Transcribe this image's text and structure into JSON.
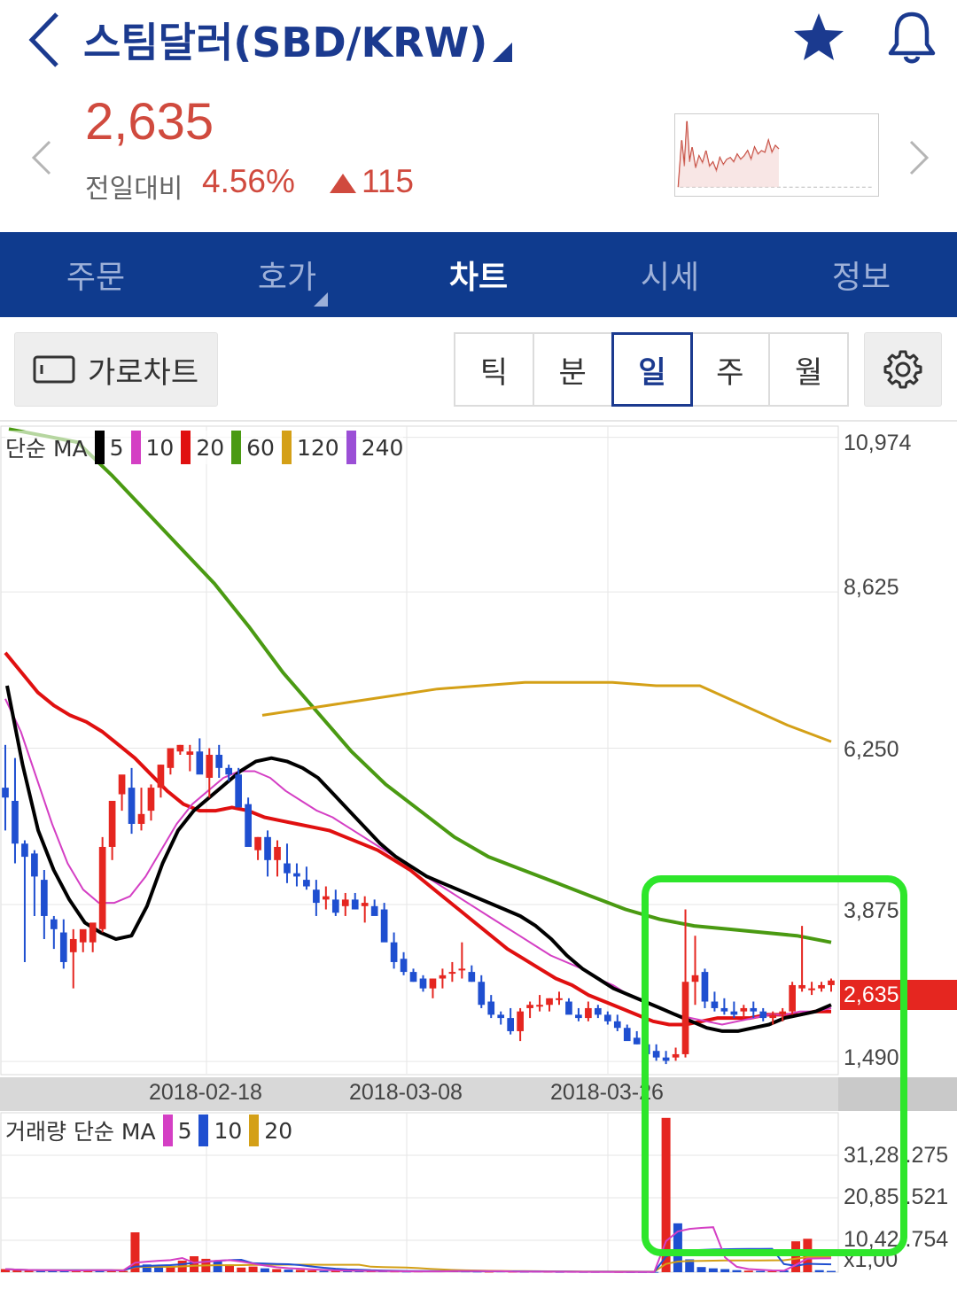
{
  "header": {
    "title": "스팀달러(SBD/KRW)",
    "icons": {
      "back": "chevron-left-icon",
      "dropdown": "caret-down-icon",
      "favorite": "star-icon",
      "alert": "bell-icon"
    },
    "colors": {
      "title": "#1b3a8f"
    }
  },
  "price": {
    "current": "2,635",
    "change_label": "전일대비",
    "change_pct": "4.56%",
    "change_abs": "115",
    "direction": "up",
    "color": "#d04a3e"
  },
  "nav": {
    "tabs": [
      {
        "label": "주문",
        "active": false
      },
      {
        "label": "호가",
        "active": false
      },
      {
        "label": "차트",
        "active": true
      },
      {
        "label": "시세",
        "active": false
      },
      {
        "label": "정보",
        "active": false
      }
    ],
    "color": "#0f3b8e"
  },
  "toolbar": {
    "landscape_label": "가로차트",
    "periods": [
      {
        "label": "틱",
        "active": false
      },
      {
        "label": "분",
        "active": false
      },
      {
        "label": "일",
        "active": true
      },
      {
        "label": "주",
        "active": false
      },
      {
        "label": "월",
        "active": false
      }
    ],
    "settings_icon": "gear-icon"
  },
  "chart_data": [
    {
      "type": "candlestick",
      "legend": {
        "label": "단순 MA",
        "periods": [
          {
            "label": "5",
            "color": "#000000"
          },
          {
            "label": "10",
            "color": "#d43fc4"
          },
          {
            "label": "20",
            "color": "#e01010"
          },
          {
            "label": "60",
            "color": "#4a9a12"
          },
          {
            "label": "120",
            "color": "#d4a017"
          },
          {
            "label": "240",
            "color": "#9b4fd6"
          }
        ]
      },
      "y_ticks": [
        "10,974",
        "8,625",
        "6,250",
        "3,875",
        "1,490"
      ],
      "y_tick_values": [
        10974,
        8625,
        6250,
        3875,
        1490
      ],
      "x_ticks": [
        "2018-02-18",
        "2018-03-08",
        "2018-03-26"
      ],
      "last_price": "2,635",
      "last_price_value": 2635,
      "up_color": "#e52620",
      "down_color": "#1f4fd0",
      "candles": [
        [
          5650,
          6300,
          5000,
          5500
        ],
        [
          5450,
          6100,
          4500,
          4800
        ],
        [
          4800,
          4850,
          3000,
          4600
        ],
        [
          4650,
          4700,
          3700,
          4300
        ],
        [
          4250,
          4400,
          3350,
          3700
        ],
        [
          3650,
          3700,
          3200,
          3500
        ],
        [
          3450,
          3650,
          2900,
          3000
        ],
        [
          3150,
          3500,
          2600,
          3350
        ],
        [
          3300,
          3400,
          3150,
          3500
        ],
        [
          3300,
          3400,
          3150,
          3600
        ],
        [
          3500,
          4900,
          3450,
          4750
        ],
        [
          4750,
          5300,
          4550,
          5450
        ],
        [
          5550,
          5700,
          5300,
          5850
        ],
        [
          5650,
          5950,
          4950,
          5100
        ],
        [
          5100,
          5650,
          5000,
          5250
        ],
        [
          5300,
          5700,
          5150,
          5650
        ],
        [
          5650,
          6000,
          5500,
          6000
        ],
        [
          5950,
          6200,
          5850,
          6250
        ],
        [
          6200,
          6300,
          6150,
          6300
        ],
        [
          6150,
          6300,
          5900,
          6200
        ],
        [
          6200,
          6400,
          5900,
          5850
        ],
        [
          5800,
          6250,
          5500,
          6150
        ],
        [
          6150,
          6300,
          5800,
          5950
        ],
        [
          5950,
          6000,
          5750,
          5850
        ],
        [
          5850,
          5950,
          5500,
          5350
        ],
        [
          5400,
          5500,
          4900,
          4750
        ],
        [
          4700,
          4900,
          4550,
          4900
        ],
        [
          4900,
          5000,
          4300,
          4550
        ],
        [
          4550,
          4850,
          4300,
          4750
        ],
        [
          4500,
          4800,
          4200,
          4350
        ],
        [
          4350,
          4500,
          4150,
          4300
        ],
        [
          4250,
          4450,
          4100,
          4150
        ],
        [
          4100,
          4250,
          3700,
          3900
        ],
        [
          3950,
          4150,
          3800,
          4000
        ],
        [
          3950,
          4100,
          3700,
          3750
        ],
        [
          3850,
          4050,
          3700,
          3950
        ],
        [
          3950,
          4050,
          3800,
          3800
        ],
        [
          3850,
          4000,
          3600,
          3900
        ],
        [
          3850,
          3950,
          3750,
          3700
        ],
        [
          3800,
          3900,
          3350,
          3300
        ],
        [
          3300,
          3450,
          2900,
          3000
        ],
        [
          3050,
          3150,
          2800,
          2850
        ],
        [
          2850,
          2900,
          2700,
          2700
        ],
        [
          2750,
          2800,
          2550,
          2600
        ],
        [
          2600,
          2750,
          2450,
          2750
        ],
        [
          2750,
          2900,
          2600,
          2800
        ],
        [
          2850,
          3000,
          2700,
          2850
        ],
        [
          2900,
          3300,
          2750,
          2900
        ],
        [
          2850,
          2950,
          2700,
          2700
        ],
        [
          2700,
          2800,
          2300,
          2350
        ],
        [
          2400,
          2500,
          2150,
          2200
        ],
        [
          2200,
          2250,
          2050,
          2150
        ],
        [
          2150,
          2300,
          1900,
          1950
        ],
        [
          1950,
          2300,
          1800,
          2250
        ],
        [
          2300,
          2400,
          2150,
          2350
        ],
        [
          2350,
          2500,
          2250,
          2350
        ],
        [
          2350,
          2450,
          2250,
          2450
        ],
        [
          2450,
          2550,
          2350,
          2450
        ],
        [
          2400,
          2450,
          2250,
          2200
        ],
        [
          2200,
          2300,
          2100,
          2150
        ],
        [
          2150,
          2400,
          2100,
          2300
        ],
        [
          2300,
          2350,
          2150,
          2200
        ],
        [
          2200,
          2250,
          2050,
          2100
        ],
        [
          2100,
          2200,
          1950,
          2000
        ],
        [
          2000,
          2050,
          1850,
          1800
        ],
        [
          1850,
          1950,
          1750,
          1750
        ],
        [
          1750,
          1850,
          1650,
          1600
        ],
        [
          1650,
          1750,
          1500,
          1550
        ],
        [
          1550,
          1650,
          1450,
          1500
        ],
        [
          1550,
          1700,
          1500,
          1600
        ],
        [
          1600,
          3800,
          1550,
          2700
        ],
        [
          2700,
          3400,
          2350,
          2800
        ],
        [
          2850,
          2900,
          2300,
          2400
        ],
        [
          2400,
          2550,
          2250,
          2300
        ],
        [
          2300,
          2450,
          2200,
          2250
        ],
        [
          2250,
          2400,
          2150,
          2200
        ],
        [
          2250,
          2350,
          2150,
          2300
        ],
        [
          2300,
          2400,
          2150,
          2250
        ],
        [
          2250,
          2300,
          2100,
          2150
        ],
        [
          2150,
          2250,
          2050,
          2200
        ],
        [
          2200,
          2300,
          2100,
          2250
        ],
        [
          2250,
          2700,
          2200,
          2650
        ],
        [
          2600,
          3550,
          2550,
          2650
        ],
        [
          2600,
          2700,
          2500,
          2600
        ],
        [
          2600,
          2700,
          2550,
          2650
        ],
        [
          2650,
          2750,
          2550,
          2720
        ]
      ],
      "ma": {
        "ma5": [
          7200,
          6000,
          5000,
          4400,
          3950,
          3600,
          3450,
          3350,
          3400,
          3850,
          4500,
          5000,
          5300,
          5500,
          5700,
          5900,
          6050,
          6100,
          6050,
          5950,
          5800,
          5550,
          5300,
          5050,
          4800,
          4600,
          4450,
          4300,
          4200,
          4100,
          4000,
          3900,
          3800,
          3700,
          3550,
          3350,
          3100,
          2900,
          2750,
          2600,
          2500,
          2400,
          2300,
          2200,
          2100,
          2000,
          1950,
          1950,
          2000,
          2050,
          2150,
          2200,
          2250,
          2350
        ],
        "ma10": [
          7000,
          6500,
          5800,
          5100,
          4500,
          4100,
          3900,
          3900,
          4000,
          4300,
          4700,
          5100,
          5400,
          5600,
          5800,
          5900,
          5900,
          5800,
          5600,
          5450,
          5300,
          5200,
          5050,
          4900,
          4750,
          4600,
          4450,
          4300,
          4150,
          4000,
          3850,
          3700,
          3550,
          3400,
          3250,
          3100,
          3000,
          2900,
          2750,
          2650,
          2500,
          2400,
          2300,
          2200,
          2150,
          2100,
          2050,
          2100,
          2150,
          2200,
          2200,
          2250,
          2250,
          2300
        ],
        "ma20": [
          7700,
          7400,
          7100,
          6900,
          6750,
          6650,
          6500,
          6300,
          6100,
          5850,
          5600,
          5400,
          5300,
          5300,
          5350,
          5300,
          5200,
          5150,
          5100,
          5050,
          5000,
          4900,
          4800,
          4700,
          4550,
          4400,
          4200,
          4000,
          3800,
          3600,
          3400,
          3200,
          3050,
          2900,
          2750,
          2650,
          2500,
          2400,
          2300,
          2200,
          2100,
          2050,
          2050,
          2100,
          2150,
          2150,
          2150,
          2200,
          2200,
          2200,
          2250,
          2250
        ],
        "ma60": [
          11100,
          11000,
          10900,
          10400,
          9850,
          9300,
          8750,
          8100,
          7400,
          6800,
          6200,
          5700,
          5300,
          4900,
          4600,
          4400,
          4200,
          4000,
          3800,
          3650,
          3550,
          3500,
          3450,
          3400,
          3300
        ],
        "ma120": [
          6750,
          6850,
          6950,
          7050,
          7150,
          7200,
          7250,
          7250,
          7250,
          7200,
          7200,
          6900,
          6600,
          6350
        ]
      }
    },
    {
      "type": "bar",
      "title": "거래량",
      "legend": {
        "label": "거래량 단순 MA",
        "periods": [
          {
            "label": "5",
            "color": "#d43fc4"
          },
          {
            "label": "10",
            "color": "#1f4fd0"
          },
          {
            "label": "20",
            "color": "#d4a017"
          }
        ]
      },
      "y_ticks": [
        "31,28 .275",
        "20,85 .521",
        "10,42 .754"
      ],
      "y_tick_values": [
        31280,
        20850,
        10420
      ],
      "unit": "x1,00",
      "volumes": [
        [
          1200,
          1
        ],
        [
          800,
          1
        ],
        [
          600,
          1
        ],
        [
          500,
          0
        ],
        [
          700,
          0
        ],
        [
          900,
          0
        ],
        [
          600,
          1
        ],
        [
          900,
          1
        ],
        [
          800,
          0
        ],
        [
          700,
          1
        ],
        [
          500,
          1
        ],
        [
          15500,
          1
        ],
        [
          3000,
          0
        ],
        [
          2500,
          0
        ],
        [
          2000,
          1
        ],
        [
          4500,
          1
        ],
        [
          6200,
          1
        ],
        [
          5200,
          1
        ],
        [
          4500,
          0
        ],
        [
          3000,
          1
        ],
        [
          1800,
          1
        ],
        [
          2200,
          1
        ],
        [
          1500,
          0
        ],
        [
          1200,
          1
        ],
        [
          1000,
          0
        ],
        [
          900,
          1
        ],
        [
          700,
          1
        ],
        [
          500,
          0
        ],
        [
          600,
          1
        ],
        [
          400,
          0
        ],
        [
          500,
          0
        ],
        [
          400,
          1
        ],
        [
          350,
          0
        ],
        [
          300,
          1
        ],
        [
          250,
          0
        ],
        [
          300,
          1
        ],
        [
          400,
          0
        ],
        [
          350,
          1
        ],
        [
          800,
          1
        ],
        [
          300,
          0
        ],
        [
          250,
          0
        ],
        [
          200,
          1
        ],
        [
          300,
          0
        ],
        [
          200,
          1
        ],
        [
          150,
          0
        ],
        [
          200,
          0
        ],
        [
          150,
          1
        ],
        [
          100,
          0
        ],
        [
          150,
          0
        ],
        [
          100,
          0
        ],
        [
          100,
          0
        ],
        [
          150,
          0
        ],
        [
          100,
          1
        ],
        [
          80,
          0
        ],
        [
          80,
          0
        ],
        [
          100,
          0
        ],
        [
          60000,
          1
        ],
        [
          19000,
          0
        ],
        [
          5000,
          0
        ],
        [
          2000,
          0
        ],
        [
          1500,
          0
        ],
        [
          1200,
          0
        ],
        [
          800,
          0
        ],
        [
          600,
          1
        ],
        [
          500,
          0
        ],
        [
          400,
          1
        ],
        [
          700,
          0
        ],
        [
          12000,
          1
        ],
        [
          13000,
          1
        ],
        [
          800,
          0
        ],
        [
          500,
          0
        ]
      ]
    }
  ]
}
